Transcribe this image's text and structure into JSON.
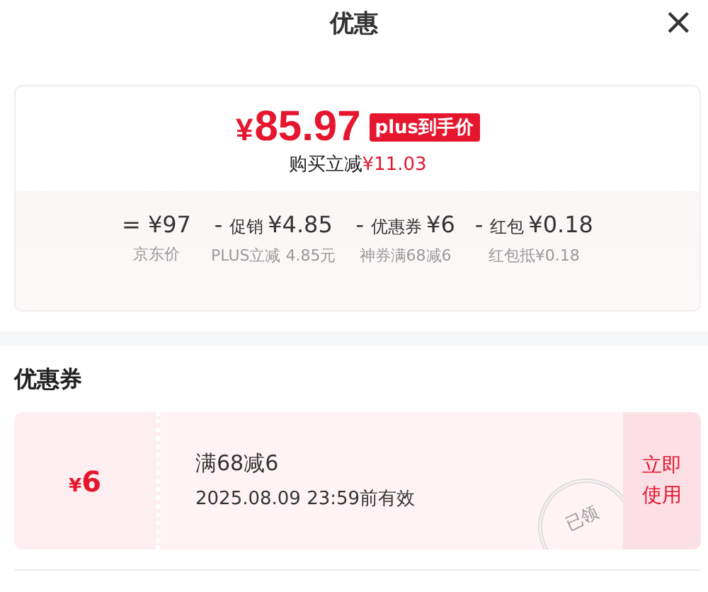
{
  "header": {
    "title": "优惠",
    "close": "×"
  },
  "price": {
    "currency": "¥",
    "amount": "85.97",
    "badge": "plus到手价",
    "savings_label": "购买立减",
    "savings_amount": "¥11.03"
  },
  "breakdown": [
    {
      "op": "=",
      "amount": "¥97",
      "note": "京东价"
    },
    {
      "op": "-",
      "name": "促销",
      "amount": "¥4.85",
      "note": "PLUS立减 4.85元"
    },
    {
      "op": "-",
      "name": "优惠券",
      "amount": "¥6",
      "note": "神券满68减6"
    },
    {
      "op": "-",
      "name": "红包",
      "amount": "¥0.18",
      "note": "红包抵¥0.18"
    }
  ],
  "coupons_section": {
    "title": "优惠券",
    "coupons": [
      {
        "currency": "¥",
        "amount": "6",
        "condition": "满68减6",
        "validity": "2025.08.09 23:59前有效",
        "stamp": "已领",
        "action": "立即使用"
      }
    ]
  }
}
